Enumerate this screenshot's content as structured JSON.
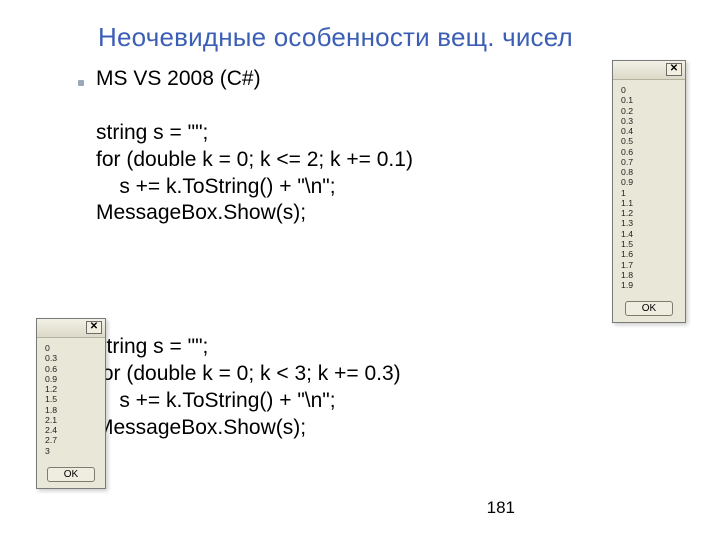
{
  "title": "Неочевидные особенности вещ. чисел",
  "page_number": "181",
  "code_top": "MS VS 2008 (C#)\n\nstring s = \"\";\nfor (double k = 0; k <= 2; k += 0.1)\n    s += k.ToString() + \"\\n\";\nMessageBox.Show(s);",
  "code_bottom": "string s = \"\";\nfor (double k = 0; k < 3; k += 0.3)\n    s += k.ToString() + \"\\n\";\nMessageBox.Show(s);",
  "msgbox_right": {
    "close_glyph": "✕",
    "values": [
      "0",
      "0.1",
      "0.2",
      "0.3",
      "0.4",
      "0.5",
      "0.6",
      "0.7",
      "0.8",
      "0.9",
      "1",
      "1.1",
      "1.2",
      "1.3",
      "1.4",
      "1.5",
      "1.6",
      "1.7",
      "1.8",
      "1.9"
    ],
    "ok_label": "OK"
  },
  "msgbox_left": {
    "close_glyph": "✕",
    "values": [
      "0",
      "0.3",
      "0.6",
      "0.9",
      "1.2",
      "1.5",
      "1.8",
      "2.1",
      "2.4",
      "2.7",
      "3"
    ],
    "ok_label": "OK"
  }
}
